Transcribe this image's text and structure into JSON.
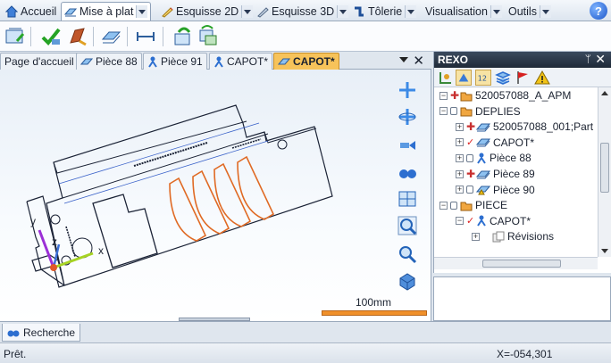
{
  "menu": {
    "tabs": [
      {
        "label": "Accueil"
      },
      {
        "label": "Mise à plat"
      },
      {
        "label": "Esquisse 2D"
      },
      {
        "label": "Esquisse 3D"
      },
      {
        "label": "Tôlerie"
      },
      {
        "label": "Visualisation"
      },
      {
        "label": "Outils"
      }
    ],
    "active_index": 1,
    "help_label": "?"
  },
  "doc_tabs": {
    "tabs": [
      {
        "label": "Page d'accueil"
      },
      {
        "label": "Pièce 88"
      },
      {
        "label": "Pièce 91"
      },
      {
        "label": "CAPOT*"
      },
      {
        "label": "CAPOT*"
      }
    ],
    "active_index": 4,
    "close_label": "✕"
  },
  "viewport": {
    "scale_label": "100mm",
    "axis_x": "x",
    "axis_y": "y",
    "axis_z": "z"
  },
  "panel": {
    "title": "REXO",
    "pin_label": "ᛘ",
    "close_label": "✕",
    "tree": [
      {
        "label": "520057088_A_APM",
        "level": 0,
        "expander": "-",
        "status": "part",
        "icon": "folder-part-icon"
      },
      {
        "label": "DEPLIES",
        "level": 0,
        "expander": "-",
        "status": "lock",
        "icon": "folder-icon"
      },
      {
        "label": "520057088_001;Part",
        "level": 1,
        "expander": "+",
        "status": "part",
        "icon": "sheet-metal-icon"
      },
      {
        "label": "CAPOT*",
        "level": 1,
        "expander": "+",
        "status": "check",
        "icon": "sheet-metal-icon"
      },
      {
        "label": "Pièce 88",
        "level": 1,
        "expander": "+",
        "status": "lock",
        "icon": "person-part-icon"
      },
      {
        "label": "Pièce 89",
        "level": 1,
        "expander": "+",
        "status": "part",
        "icon": "sheet-metal-icon"
      },
      {
        "label": "Pièce 90",
        "level": 1,
        "expander": "+",
        "status": "lock",
        "icon": "sheet-metal-warning-icon"
      },
      {
        "label": "PIECE",
        "level": 0,
        "expander": "-",
        "status": "lock",
        "icon": "folder-icon"
      },
      {
        "label": "CAPOT*",
        "level": 1,
        "expander": "-",
        "status": "check",
        "icon": "person-part-icon"
      },
      {
        "label": "Révisions",
        "level": 2,
        "expander": "+",
        "status": "",
        "icon": "revisions-icon"
      }
    ]
  },
  "bottom": {
    "search_tab_label": "Recherche"
  },
  "status": {
    "text": "Prêt.",
    "coordinate": "X=-054,301"
  },
  "colors": {
    "accent_orange": "#f7c35a",
    "flat_pattern_outline": "#e06a24",
    "drawing_line": "#1a2235",
    "panel_title": "#2a3648"
  }
}
